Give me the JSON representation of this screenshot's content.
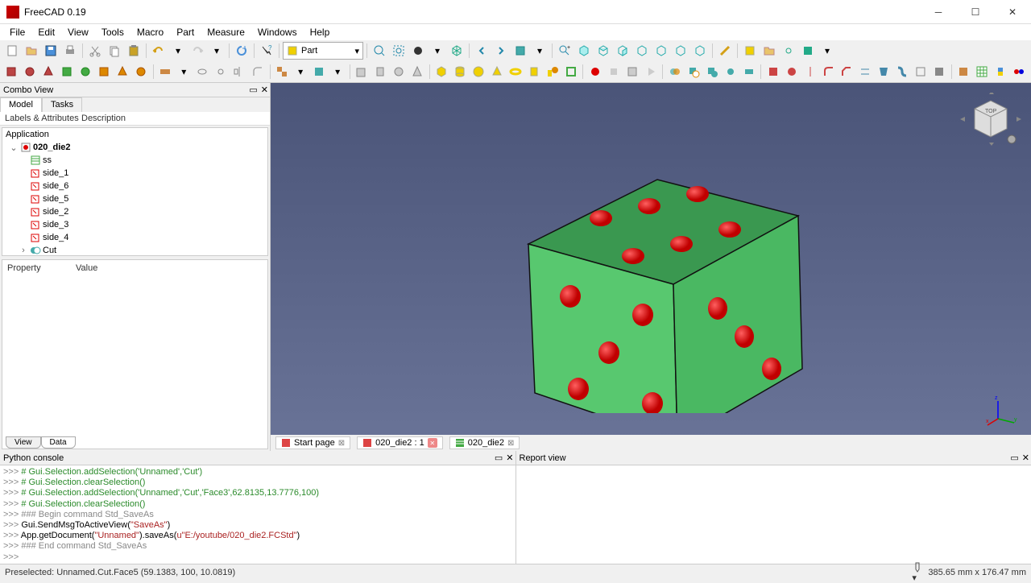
{
  "window": {
    "title": "FreeCAD 0.19"
  },
  "menu": [
    "File",
    "Edit",
    "View",
    "Tools",
    "Macro",
    "Part",
    "Measure",
    "Windows",
    "Help"
  ],
  "workbench": {
    "selected": "Part"
  },
  "combo_view": {
    "title": "Combo View",
    "tabs": [
      "Model",
      "Tasks"
    ],
    "tree_headers": [
      "Labels & Attributes",
      "Description"
    ],
    "root_label": "Application",
    "doc_label": "020_die2",
    "items": [
      "ss",
      "side_1",
      "side_6",
      "side_5",
      "side_2",
      "side_3",
      "side_4",
      "Cut"
    ],
    "prop_headers": [
      "Property",
      "Value"
    ],
    "bottom_tabs": [
      "View",
      "Data"
    ]
  },
  "doc_tabs": [
    {
      "label": "Start page",
      "closable": true
    },
    {
      "label": "020_die2 : 1",
      "closable": true
    },
    {
      "label": "020_die2",
      "closable": true
    }
  ],
  "python_console": {
    "title": "Python console",
    "lines": [
      {
        "type": "comment",
        "text": "# Gui.Selection.addSelection('Unnamed','Cut')"
      },
      {
        "type": "comment",
        "text": "# Gui.Selection.clearSelection()"
      },
      {
        "type": "comment",
        "text": "# Gui.Selection.addSelection('Unnamed','Cut','Face3',62.8135,13.7776,100)"
      },
      {
        "type": "comment",
        "text": "# Gui.Selection.clearSelection()"
      },
      {
        "type": "hash",
        "text": "### Begin command Std_SaveAs"
      },
      {
        "type": "code",
        "text": "Gui.SendMsgToActiveView(\"SaveAs\")"
      },
      {
        "type": "code",
        "text": "App.getDocument(\"Unnamed\").saveAs(u\"E:/youtube/020_die2.FCStd\")"
      },
      {
        "type": "hash",
        "text": "### End command Std_SaveAs"
      }
    ]
  },
  "report_view": {
    "title": "Report view"
  },
  "statusbar": {
    "left": "Preselected: Unnamed.Cut.Face5 (59.1383, 100, 10.0819)",
    "right": "385.65 mm x 176.47 mm"
  }
}
